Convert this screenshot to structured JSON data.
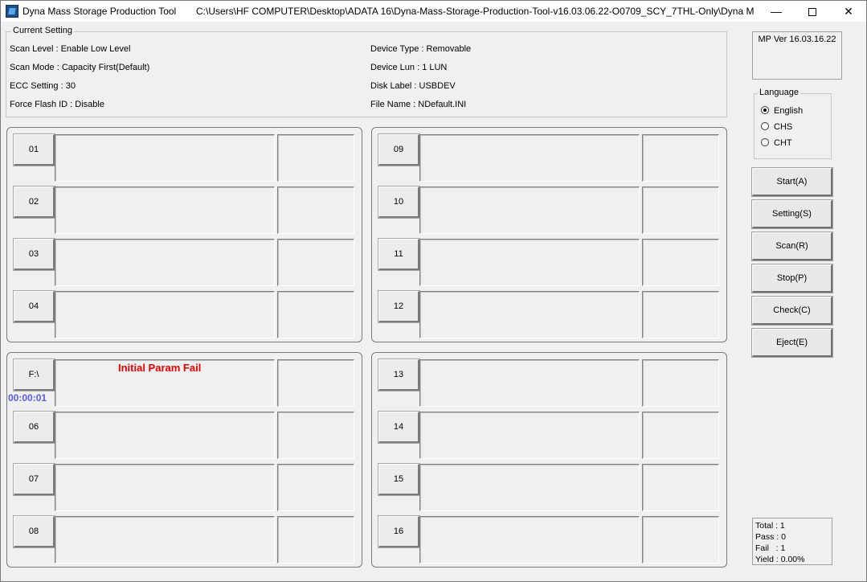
{
  "window": {
    "app_title": "Dyna Mass Storage Production Tool",
    "path_title": "C:\\Users\\HF COMPUTER\\Desktop\\ADATA 16\\Dyna-Mass-Storage-Production-Tool-v16.03.06.22-O0709_SCY_7THL-Only\\Dyna Mass",
    "minimize": "—",
    "close": "✕"
  },
  "current_setting": {
    "legend": "Current Setting",
    "left": [
      "Scan Level : Enable Low Level",
      "Scan Mode : Capacity First(Default)",
      "ECC Setting : 30",
      "Force Flash ID : Disable"
    ],
    "right": [
      "Device Type : Removable",
      "Device Lun : 1 LUN",
      "Disk Label : USBDEV",
      "File Name : NDefault.INI"
    ]
  },
  "version": "MP Ver 16.03.16.22",
  "language": {
    "legend": "Language",
    "options": [
      {
        "label": "English",
        "selected": true
      },
      {
        "label": "CHS",
        "selected": false
      },
      {
        "label": "CHT",
        "selected": false
      }
    ]
  },
  "actions": [
    "Start(A)",
    "Setting(S)",
    "Scan(R)",
    "Stop(P)",
    "Check(C)",
    "Eject(E)"
  ],
  "ports": {
    "group1": [
      "01",
      "02",
      "03",
      "04"
    ],
    "group2": [
      "09",
      "10",
      "11",
      "12"
    ],
    "group3": [
      "F:\\",
      "06",
      "07",
      "08"
    ],
    "group4": [
      "13",
      "14",
      "15",
      "16"
    ]
  },
  "port_status": {
    "message": "Initial Param Fail",
    "timer": "00:00:01",
    "message_color": "#e00000",
    "timer_color": "#5a5af0"
  },
  "stats": {
    "total": "Total : 1",
    "pass": "Pass : 0",
    "fail": "Fail   : 1",
    "yield": "Yield : 0.00%"
  }
}
